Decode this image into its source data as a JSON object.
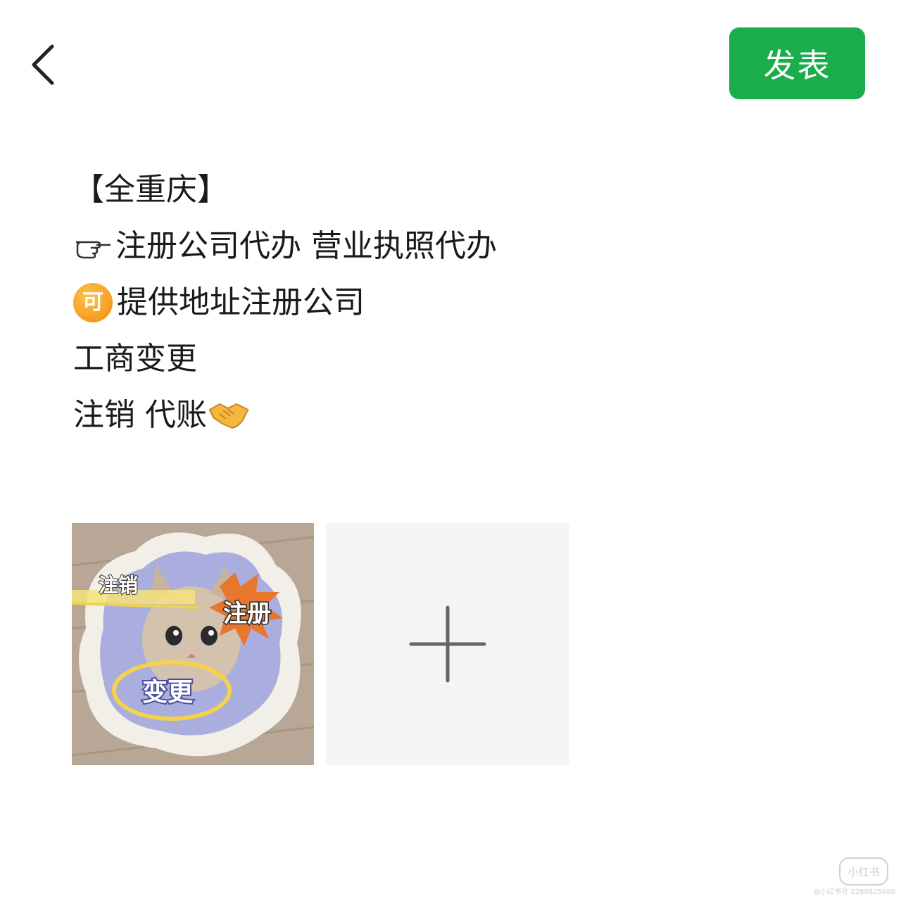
{
  "header": {
    "back_icon": "chevron-left-icon",
    "publish_label": "发表",
    "publish_color": "#1aad4b"
  },
  "post": {
    "line1": "【全重庆】",
    "line2_icon": "pointing-hand-icon",
    "line2_text": "注册公司代办 营业执照代办",
    "line3_badge": "可",
    "line3_text": "提供地址注册公司",
    "line4": "工商变更",
    "line5_text": "注销 代账",
    "line5_icon": "handshake-icon"
  },
  "images": {
    "photo_stickers": [
      "注销",
      "注册",
      "变更"
    ],
    "add_icon": "plus-icon"
  },
  "watermark": {
    "logo": "小红书",
    "id_text": "@小红书号 2280825660"
  }
}
